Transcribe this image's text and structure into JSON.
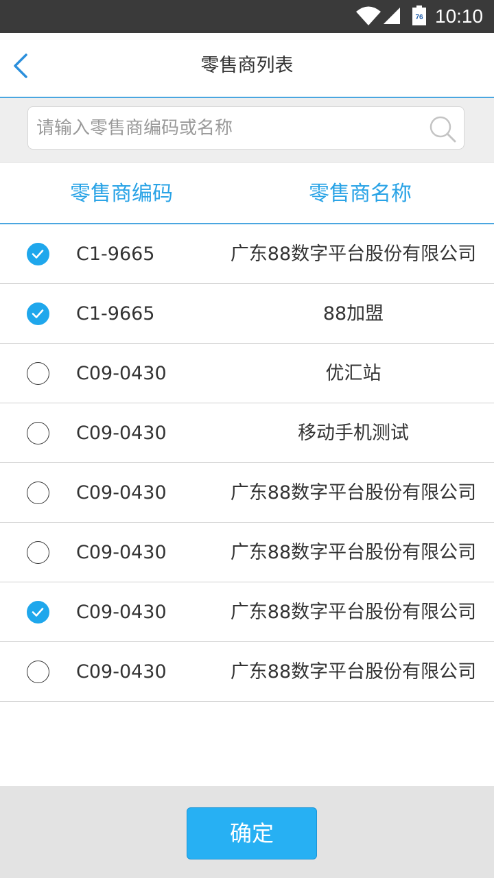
{
  "status_bar": {
    "time": "10:10",
    "battery_level": "76"
  },
  "nav": {
    "title": "零售商列表"
  },
  "search": {
    "placeholder": "请输入零售商编码或名称",
    "value": ""
  },
  "table": {
    "headers": {
      "code": "零售商编码",
      "name": "零售商名称"
    },
    "rows": [
      {
        "code": "C1-9665",
        "name": "广东88数字平台股份有限公司",
        "checked": true
      },
      {
        "code": "C1-9665",
        "name": "88加盟",
        "checked": true
      },
      {
        "code": "C09-0430",
        "name": "优汇站",
        "checked": false
      },
      {
        "code": "C09-0430",
        "name": "移动手机测试",
        "checked": false
      },
      {
        "code": "C09-0430",
        "name": "广东88数字平台股份有限公司",
        "checked": false
      },
      {
        "code": "C09-0430",
        "name": "广东88数字平台股份有限公司",
        "checked": false
      },
      {
        "code": "C09-0430",
        "name": "广东88数字平台股份有限公司",
        "checked": true
      },
      {
        "code": "C09-0430",
        "name": "广东88数字平台股份有限公司",
        "checked": false
      }
    ]
  },
  "footer": {
    "confirm_label": "确定"
  },
  "colors": {
    "accent": "#29a3e6",
    "check": "#1fa7ec",
    "button": "#27b0f3",
    "status_bar": "#3a3a3a"
  }
}
